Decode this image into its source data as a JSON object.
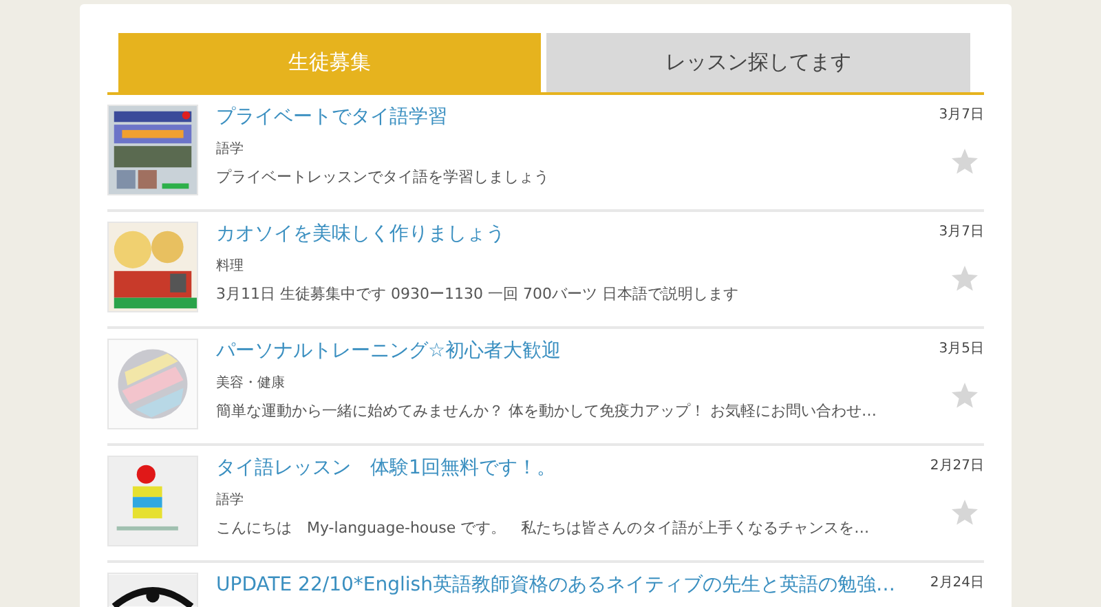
{
  "tabs": [
    {
      "label": "生徒募集",
      "selected": true
    },
    {
      "label": "レッスン探してます",
      "selected": false
    }
  ],
  "posts": [
    {
      "title": "プライベートでタイ語学習",
      "category": "語学",
      "description": "プライベートレッスンでタイ語を学習しましょう",
      "date": "3月7日",
      "starred": false
    },
    {
      "title": "カオソイを美味しく作りましょう",
      "category": "料理",
      "description": "3月11日 生徒募集中です 0930ー1130 一回 700バーツ 日本語で説明します",
      "date": "3月7日",
      "starred": false
    },
    {
      "title": "パーソナルトレーニング☆初心者大歓迎",
      "category": "美容・健康",
      "description": "簡単な運動から一緒に始めてみませんか？ 体を動かして免疫力アップ！ お気軽にお問い合わせ…",
      "date": "3月5日",
      "starred": false
    },
    {
      "title": "タイ語レッスン　体験1回無料です！。",
      "category": "語学",
      "description": "こんにちは　My-language-house です。　私たちは皆さんのタイ語が上手くなるチャンスを…",
      "date": "2月27日",
      "starred": false
    },
    {
      "title": "UPDATE 22/10*English英語教師資格のあるネイティブの先生と英語の勉強…",
      "date": "2月24日"
    }
  ]
}
